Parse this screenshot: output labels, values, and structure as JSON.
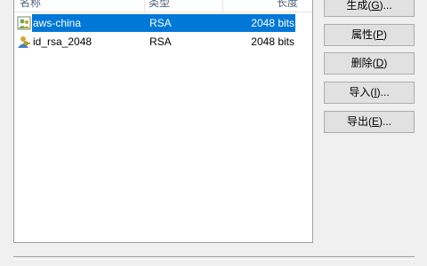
{
  "key_list": {
    "columns": {
      "name": "名称",
      "type": "类型",
      "length": "长度"
    },
    "rows": [
      {
        "name": "aws-china",
        "type": "RSA",
        "length": "2048 bits",
        "selected": true,
        "icon": "key-pair-icon"
      },
      {
        "name": "id_rsa_2048",
        "type": "RSA",
        "length": "2048 bits",
        "selected": false,
        "icon": "key-user-icon"
      }
    ]
  },
  "buttons": {
    "generate": {
      "text": "生成(",
      "mnemonic": "G",
      "suffix": ")..."
    },
    "properties": {
      "text": "属性(",
      "mnemonic": "P",
      "suffix": ")"
    },
    "delete": {
      "text": "删除(",
      "mnemonic": "D",
      "suffix": ")"
    },
    "import": {
      "text": "导入(",
      "mnemonic": "I",
      "suffix": ")..."
    },
    "export": {
      "text": "导出(",
      "mnemonic": "E",
      "suffix": ")..."
    }
  },
  "colors": {
    "selection": "#0078d7",
    "window_bg": "#f0f0f0",
    "header_text": "#4c607a"
  }
}
